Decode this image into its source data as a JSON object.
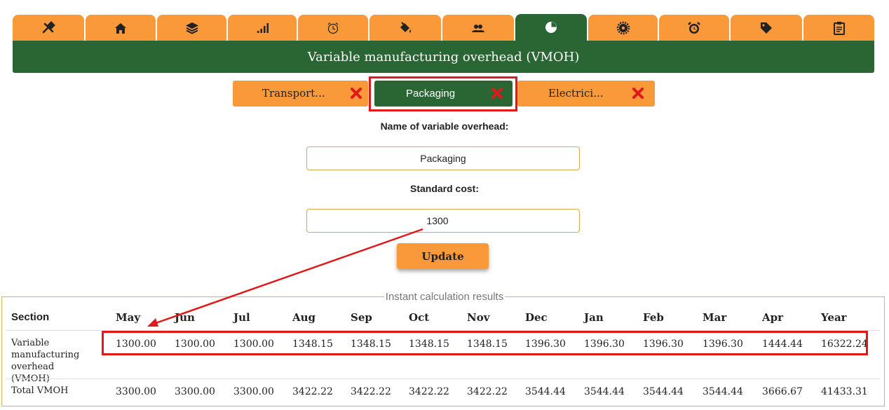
{
  "tabs": [
    {
      "icon": "tools-icon"
    },
    {
      "icon": "home-icon"
    },
    {
      "icon": "layers-icon"
    },
    {
      "icon": "signal-bars-icon"
    },
    {
      "icon": "alarm-clock-outline-icon"
    },
    {
      "icon": "paint-bucket-icon"
    },
    {
      "icon": "users-icon"
    },
    {
      "icon": "pie-chart-icon",
      "active": true
    },
    {
      "icon": "gear-icon"
    },
    {
      "icon": "alarm-clock-icon"
    },
    {
      "icon": "tag-icon"
    },
    {
      "icon": "clipboard-icon"
    }
  ],
  "banner_title": "Variable manufacturing overhead (VMOH)",
  "overhead_tabs": [
    {
      "label": "Transport..."
    },
    {
      "label": "Packaging",
      "active": true
    },
    {
      "label": "Electrici..."
    }
  ],
  "form": {
    "name_label": "Name of variable overhead:",
    "name_value": "Packaging",
    "cost_label": "Standard cost:",
    "cost_value": "1300",
    "update_label": "Update"
  },
  "results": {
    "legend": "Instant calculation results",
    "headers": [
      "Section",
      "May",
      "Jun",
      "Jul",
      "Aug",
      "Sep",
      "Oct",
      "Nov",
      "Dec",
      "Jan",
      "Feb",
      "Mar",
      "Apr",
      "Year"
    ],
    "rows": [
      {
        "section": "Variable manufacturing overhead (VMOH)",
        "values": [
          "1300.00",
          "1300.00",
          "1300.00",
          "1348.15",
          "1348.15",
          "1348.15",
          "1348.15",
          "1396.30",
          "1396.30",
          "1396.30",
          "1396.30",
          "1444.44",
          "16322.24"
        ]
      },
      {
        "section": "Total VMOH",
        "values": [
          "3300.00",
          "3300.00",
          "3300.00",
          "3422.22",
          "3422.22",
          "3422.22",
          "3422.22",
          "3544.44",
          "3544.44",
          "3544.44",
          "3544.44",
          "3666.67",
          "41433.31"
        ]
      }
    ]
  },
  "colors": {
    "orange": "#f9993a",
    "green": "#2a6534",
    "highlight": "#e01a1a",
    "delete": "#e01a1a"
  }
}
